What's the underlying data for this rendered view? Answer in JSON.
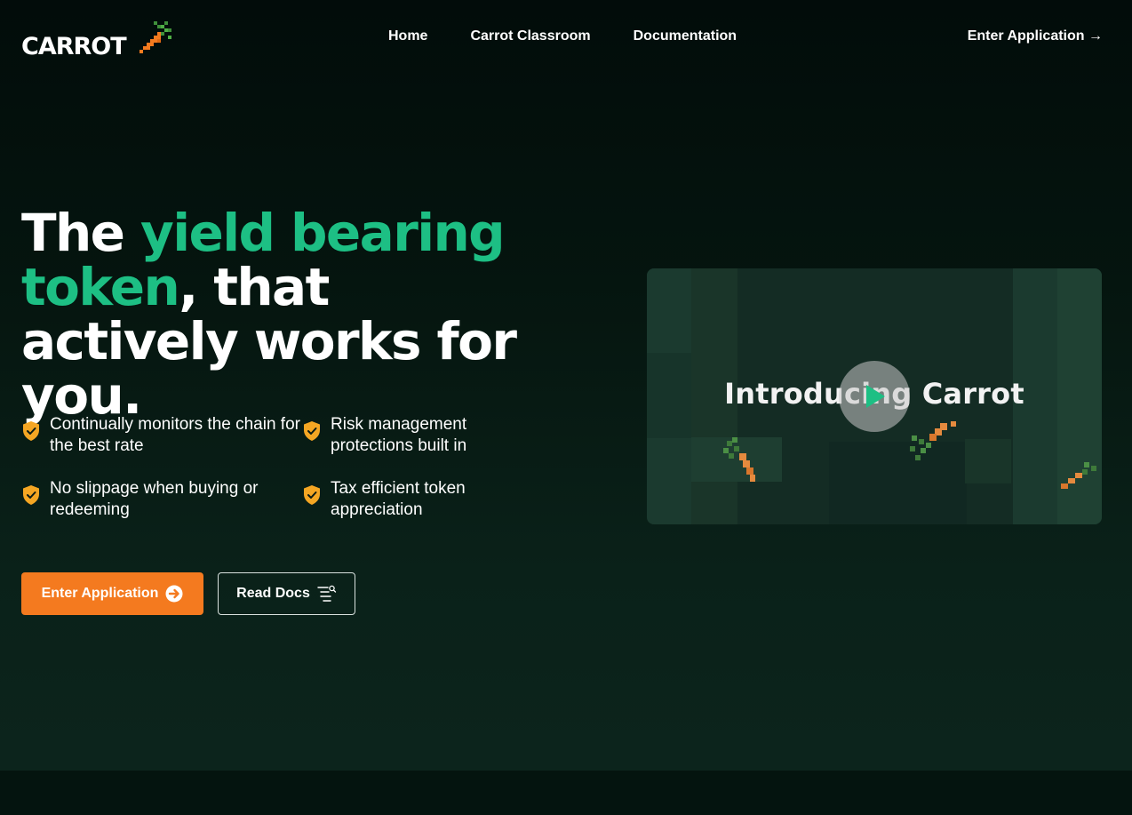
{
  "brand": {
    "name": "CARROT",
    "logo_icon": "pixel-carrot-icon",
    "accent": "#f47a1f",
    "green": "#1dbf84"
  },
  "nav": {
    "links": [
      "Home",
      "Carrot Classroom",
      "Documentation"
    ],
    "cta": "Enter Application →"
  },
  "hero": {
    "title_part1": "The ",
    "title_green1": "yield bearing",
    "title_green2": "token",
    "title_part2": ", that actively works for you.",
    "features": [
      {
        "icon": "shield-check-icon",
        "text": "Continually monitors the chain for the best rate"
      },
      {
        "icon": "shield-check-icon",
        "text": "Risk management protections built in"
      },
      {
        "icon": "shield-check-icon",
        "text": "No slippage when buying or redeeming"
      },
      {
        "icon": "shield-check-icon",
        "text": "Tax efficient token appreciation"
      }
    ],
    "primary_button": "Enter Application",
    "primary_button_icon": "arrow-right-circle-icon",
    "secondary_button": "Read Docs",
    "secondary_button_icon": "docs-search-icon"
  },
  "video": {
    "title": "Introducing Carrot",
    "play_icon": "play-icon"
  }
}
